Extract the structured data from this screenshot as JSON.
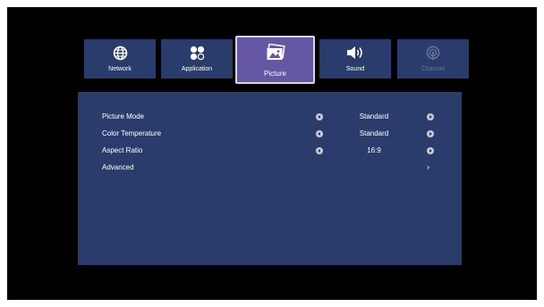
{
  "tabs": [
    {
      "label": "Network",
      "icon": "globe-icon",
      "state": "normal"
    },
    {
      "label": "Application",
      "icon": "apps-icon",
      "state": "normal"
    },
    {
      "label": "Picture",
      "icon": "picture-icon",
      "state": "active"
    },
    {
      "label": "Sound",
      "icon": "speaker-icon",
      "state": "normal"
    },
    {
      "label": "Channel",
      "icon": "antenna-icon",
      "state": "disabled"
    }
  ],
  "settings": [
    {
      "label": "Picture Mode",
      "value": "Standard"
    },
    {
      "label": "Color Temperature",
      "value": "Standard"
    },
    {
      "label": "Aspect Ratio",
      "value": "16:9"
    },
    {
      "label": "Advanced",
      "value": ""
    }
  ],
  "colors": {
    "background": "#000000",
    "panel": "#2a3c6b",
    "active_tab": "#6657a4",
    "text": "#ffffff",
    "disabled_text": "#6a7596"
  }
}
